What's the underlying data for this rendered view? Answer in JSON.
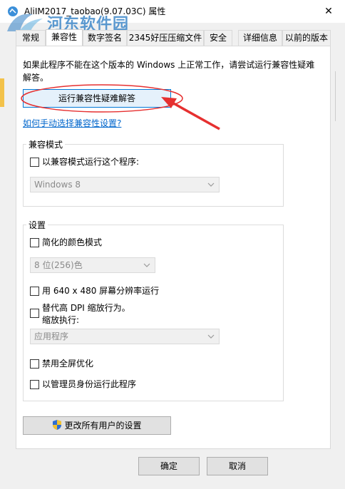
{
  "window": {
    "title": "AliIM2017_taobao(9.07.03C) 属性",
    "close_label": "✕"
  },
  "watermark": {
    "text": "河东软件园",
    "url": "www.pc0359.cn"
  },
  "tabs": [
    {
      "label": "常规"
    },
    {
      "label": "兼容性"
    },
    {
      "label": "数字签名"
    },
    {
      "label": "2345好压压缩文件"
    },
    {
      "label": "安全"
    },
    {
      "label": "详细信息"
    },
    {
      "label": "以前的版本"
    }
  ],
  "compat": {
    "intro": "如果此程序不能在这个版本的 Windows 上正常工作，请尝试运行兼容性疑难解答。",
    "run_troubleshooter_label": "运行兼容性疑难解答",
    "manual_link": "如何手动选择兼容性设置?"
  },
  "mode_group": {
    "title": "兼容模式",
    "checkbox_label": "以兼容模式运行这个程序:",
    "os_select_value": "Windows 8"
  },
  "settings_group": {
    "title": "设置",
    "reduced_color_label": "简化的颜色模式",
    "color_select_value": "8 位(256)色",
    "res_640_label": "用 640 x 480 屏幕分辨率运行",
    "dpi_override_label": "替代高 DPI 缩放行为。",
    "dpi_scaling_label": "缩放执行:",
    "dpi_select_value": "应用程序",
    "disable_fullscreen_label": "禁用全屏优化",
    "run_as_admin_label": "以管理员身份运行此程序"
  },
  "change_all_users_label": "更改所有用户的设置",
  "footer": {
    "ok_label": "确定",
    "cancel_label": "取消"
  },
  "colors": {
    "accent": "#0078d7",
    "annotation_red": "#e63030",
    "link": "#0066cc"
  },
  "icons": {
    "app": "app-icon",
    "shield": "uac-shield-icon",
    "chevron": "chevron-down-icon"
  }
}
